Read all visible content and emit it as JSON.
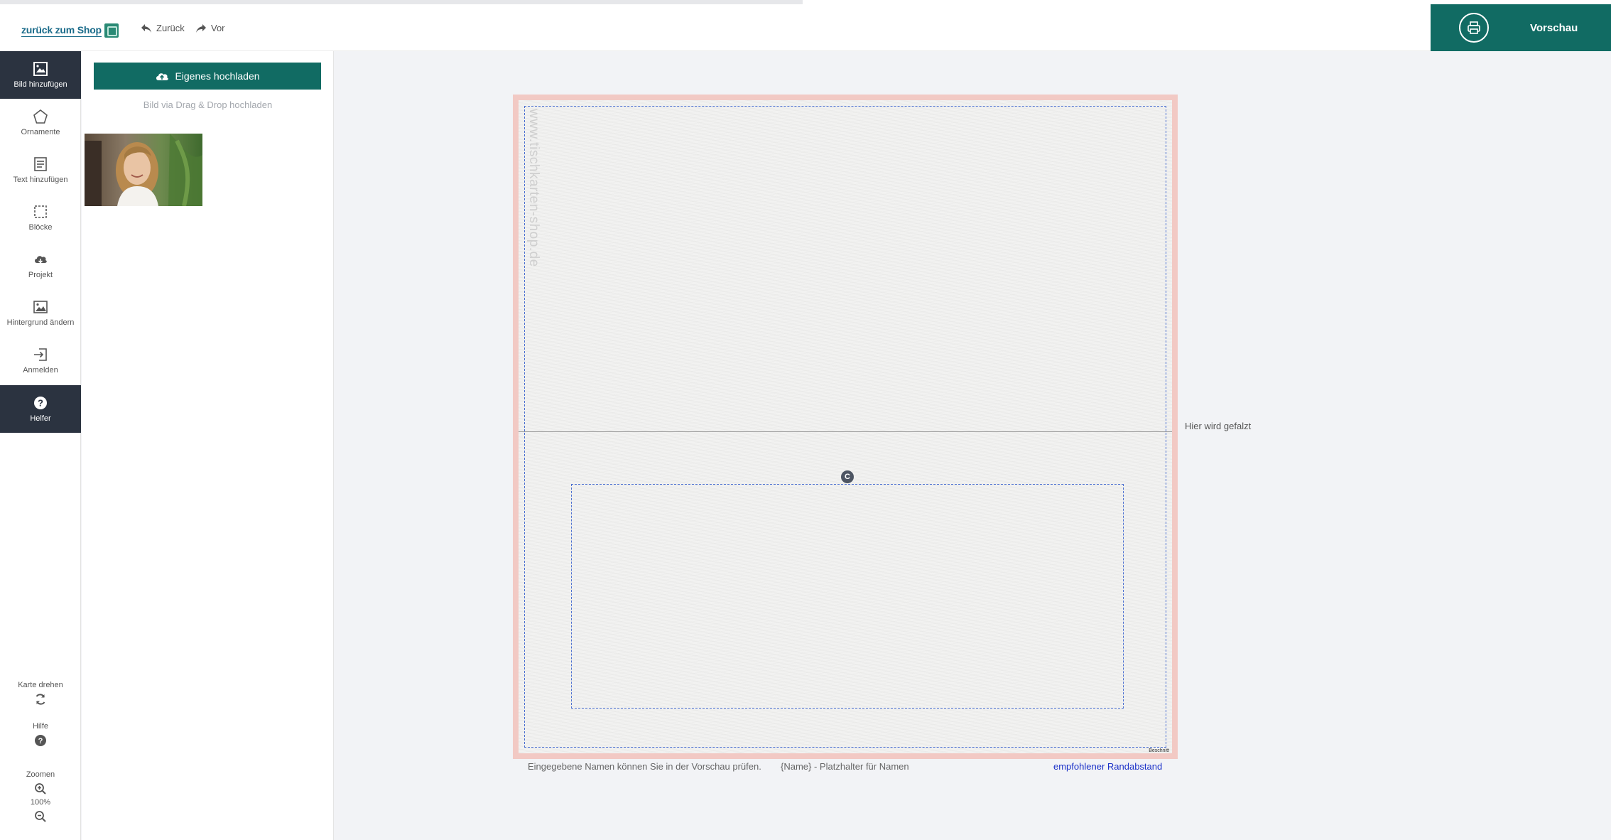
{
  "header": {
    "logo_text": "zurück zum Shop",
    "back_label": "Zurück",
    "forward_label": "Vor",
    "preview_label": "Vorschau"
  },
  "sidebar": {
    "items": [
      {
        "label": "Bild hinzufügen",
        "icon": "image-add-icon",
        "active": true
      },
      {
        "label": "Ornamente",
        "icon": "pentagon-icon",
        "active": false
      },
      {
        "label": "Text hinzufügen",
        "icon": "text-lines-icon",
        "active": false
      },
      {
        "label": "Blöcke",
        "icon": "dashed-square-icon",
        "active": false
      },
      {
        "label": "Projekt",
        "icon": "cloud-download-icon",
        "active": false
      },
      {
        "label": "Hintergrund ändern",
        "icon": "picture-icon",
        "active": false
      },
      {
        "label": "Anmelden",
        "icon": "login-icon",
        "active": false
      },
      {
        "label": "Helfer",
        "icon": "question-circle-icon",
        "active": true
      }
    ],
    "tools": {
      "rotate_label": "Karte drehen",
      "help_label": "Hilfe",
      "zoom_label": "Zoomen",
      "zoom_value": "100%"
    }
  },
  "panel": {
    "upload_label": "Eigenes hochladen",
    "dnd_hint": "Bild via Drag & Drop hochladen"
  },
  "canvas": {
    "watermark": "www.tischkarten-shop.de",
    "fold_label": "Hier wird gefalzt",
    "handle_label": "C",
    "beschnitt_label": "Beschnitt"
  },
  "footer": {
    "note_preview": "Eingegebene Namen können Sie in der Vorschau prüfen.",
    "note_placeholder": "{Name} - Platzhalter für Namen",
    "note_margin_link": "empfohlener Randabstand"
  },
  "colors": {
    "accent": "#116b63",
    "sidebar_active": "#2b3340",
    "bleed": "#f2c9c4",
    "guide": "#4a6fd1"
  }
}
